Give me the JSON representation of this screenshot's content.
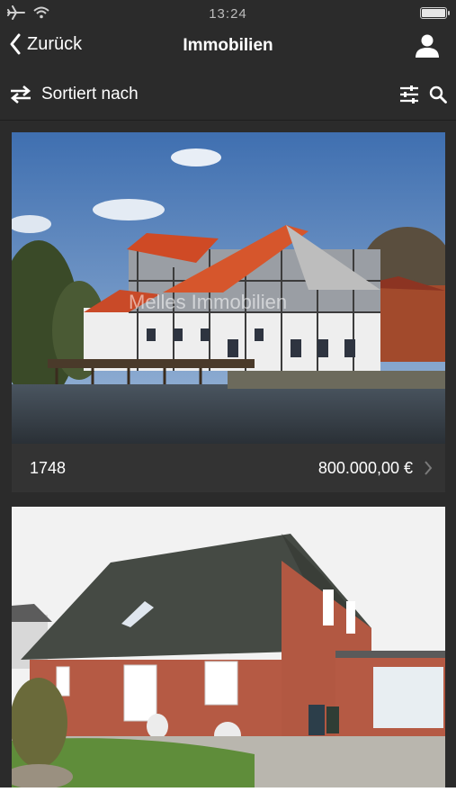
{
  "status_bar": {
    "time": "13:24"
  },
  "nav": {
    "back_label": "Zurück",
    "title": "Immobilien"
  },
  "sort": {
    "label": "Sortiert nach"
  },
  "listings": [
    {
      "id": "1748",
      "price": "800.000,00 €",
      "watermark": "Melles Immobilien"
    },
    {
      "id": "",
      "price": ""
    }
  ],
  "colors": {
    "background": "#2b2b2b",
    "card": "#333333",
    "text": "#ffffff"
  },
  "icons": {
    "back": "chevron-left-icon",
    "user": "user-icon",
    "sort": "swap-arrows-icon",
    "filter": "sliders-icon",
    "search": "search-icon",
    "disclosure": "chevron-right-icon"
  }
}
